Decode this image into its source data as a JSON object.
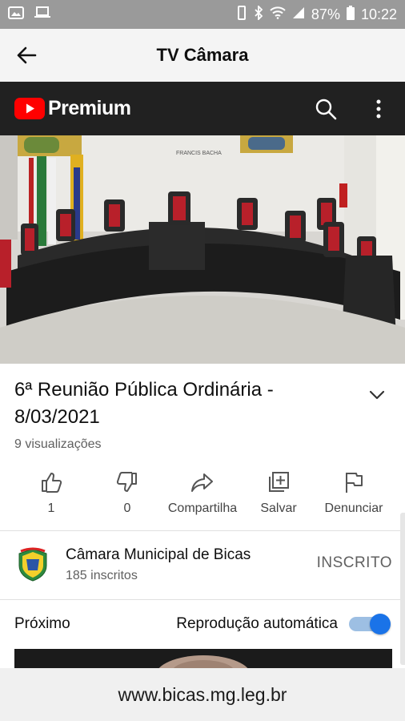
{
  "status_bar": {
    "battery": "87%",
    "time": "10:22"
  },
  "app_header": {
    "title": "TV Câmara"
  },
  "youtube": {
    "brand": "Premium",
    "brand_color": "#ff0000"
  },
  "video": {
    "wall_text": "FRANCIS BACHA",
    "title": "6ª Reunião Pública Ordinária - 8/03/2021",
    "views": "9 visualizações"
  },
  "actions": {
    "like_count": "1",
    "dislike_count": "0",
    "share_label": "Compartilha",
    "save_label": "Salvar",
    "report_label": "Denunciar"
  },
  "channel": {
    "name": "Câmara Municipal de Bicas",
    "subscribers": "185 inscritos",
    "subscribed_label": "INSCRITO"
  },
  "next": {
    "label": "Próximo",
    "autoplay_label": "Reprodução automática",
    "autoplay_on": true,
    "accent": "#1a73e8"
  },
  "footer": {
    "url": "www.bicas.mg.leg.br"
  }
}
